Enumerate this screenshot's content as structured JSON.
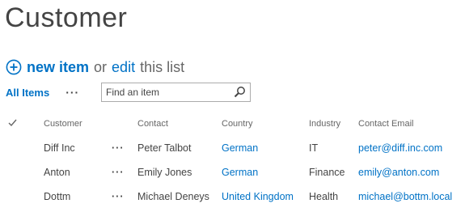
{
  "page": {
    "title": "Customer"
  },
  "actions": {
    "new_item": "new item",
    "or": "or",
    "edit": "edit",
    "this_list": "this list"
  },
  "view": {
    "all_items": "All Items",
    "more": "···",
    "search_placeholder": "Find an item"
  },
  "table": {
    "headers": [
      "Customer",
      "Contact",
      "Country",
      "Industry",
      "Contact Email"
    ],
    "rows": [
      {
        "customer": "Diff Inc",
        "menu": "···",
        "contact": "Peter Talbot",
        "country": "German",
        "industry": "IT",
        "email": "peter@diff.inc.com"
      },
      {
        "customer": "Anton",
        "menu": "···",
        "contact": "Emily Jones",
        "country": "German",
        "industry": "Finance",
        "email": "emily@anton.com"
      },
      {
        "customer": "Dottm",
        "menu": "···",
        "contact": "Michael Deneys",
        "country": "United Kingdom",
        "industry": "Health",
        "email": "michael@bottm.local"
      }
    ]
  },
  "colors": {
    "accent": "#0072c6",
    "text": "#444444"
  }
}
